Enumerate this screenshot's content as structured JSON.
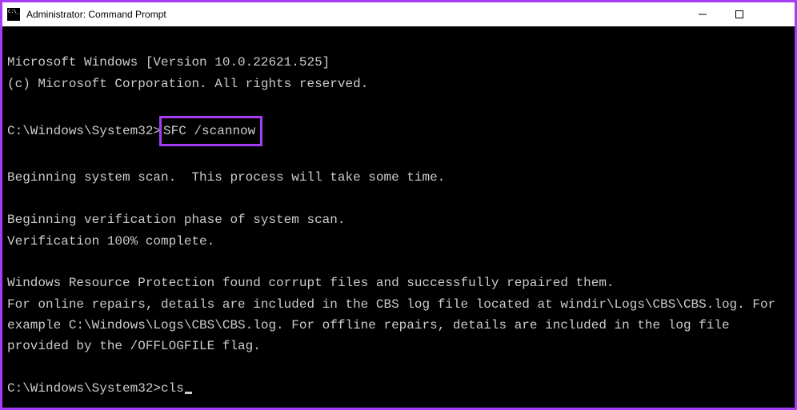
{
  "window": {
    "title": "Administrator: Command Prompt"
  },
  "terminal": {
    "line1": "Microsoft Windows [Version 10.0.22621.525]",
    "line2": "(c) Microsoft Corporation. All rights reserved.",
    "prompt1_path": "C:\\Windows\\System32>",
    "prompt1_cmd": "SFC /scannow",
    "line3": "Beginning system scan.  This process will take some time.",
    "line4": "Beginning verification phase of system scan.",
    "line5": "Verification 100% complete.",
    "line6": "Windows Resource Protection found corrupt files and successfully repaired them.",
    "line7": "For online repairs, details are included in the CBS log file located at windir\\Logs\\CBS\\CBS.log. For example C:\\Windows\\Logs\\CBS\\CBS.log. For offline repairs, details are included in the log file provided by the /OFFLOGFILE flag.",
    "prompt2_path": "C:\\Windows\\System32>",
    "prompt2_cmd": "cls"
  }
}
